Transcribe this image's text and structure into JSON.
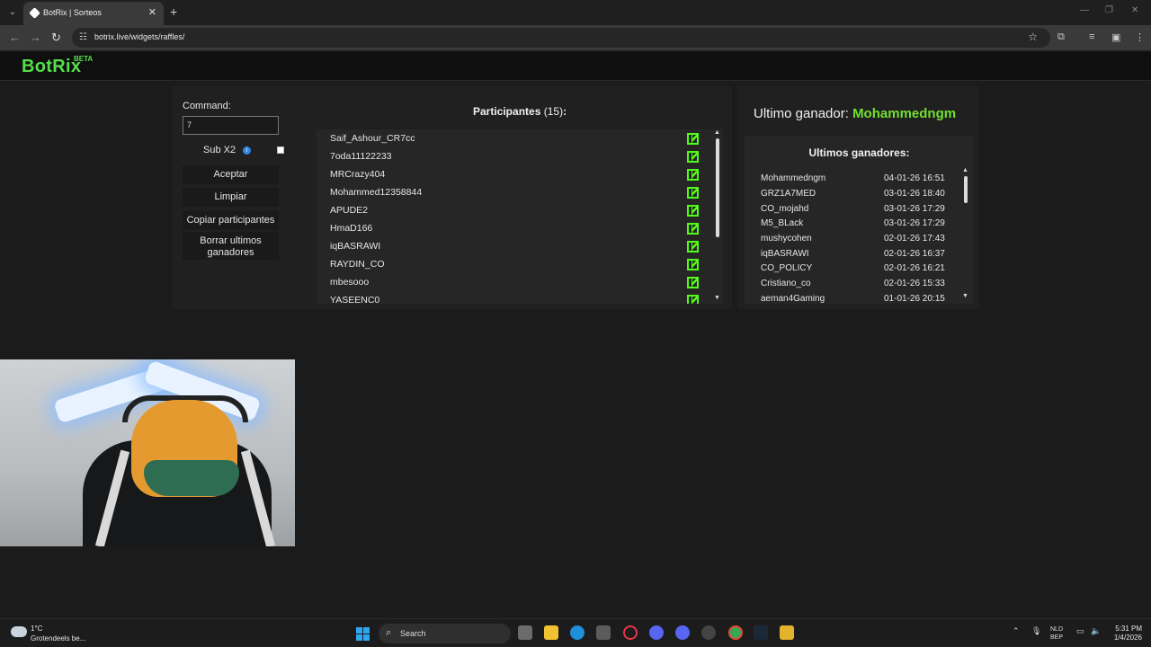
{
  "browser": {
    "tab_title": "BotRix | Sorteos",
    "url": "botrix.live/widgets/raffles/"
  },
  "site": {
    "logo": "BotRix",
    "beta": "BETA"
  },
  "raffle": {
    "command_label": "Command:",
    "command_value": "7",
    "sub_label": "Sub X2",
    "sub_checked": false,
    "buttons": [
      "Aceptar",
      "Limpiar",
      "Copiar participantes",
      "Borrar ultimos ganadores"
    ],
    "participants_title": "Participantes",
    "participants_count": "(15)",
    "participants_suffix": ":",
    "participants": [
      "Saif_Ashour_CR7cc",
      "7oda11122233",
      "MRCrazy404",
      "Mohammed12358844",
      "APUDE2",
      "HmaD166",
      "iqBASRAWI",
      "RAYDIN_CO",
      "mbesooo",
      "YASEENC0"
    ],
    "platform_icon": "kick-icon"
  },
  "winners": {
    "last_winner_label": "Ultimo ganador:",
    "last_winner_name": "Mohammedngm",
    "list_title": "Ultimos ganadores:",
    "list": [
      {
        "name": "Mohammedngm",
        "date": "04-01-26 16:51"
      },
      {
        "name": "GRZ1A7MED",
        "date": "03-01-26 18:40"
      },
      {
        "name": "CO_mojahd",
        "date": "03-01-26 17:29"
      },
      {
        "name": "M5_BLack",
        "date": "03-01-26 17:29"
      },
      {
        "name": "mushycohen",
        "date": "02-01-26 17:43"
      },
      {
        "name": "iqBASRAWI",
        "date": "02-01-26 16:37"
      },
      {
        "name": "CO_POLICY",
        "date": "02-01-26 16:21"
      },
      {
        "name": "Cristiano_co",
        "date": "02-01-26 15:33"
      },
      {
        "name": "aeman4Gaming",
        "date": "01-01-26 20:15"
      }
    ]
  },
  "taskbar": {
    "temperature": "1°C",
    "weather": "Grotendeels be...",
    "search": "Search",
    "lang_top": "NLD",
    "lang_bottom": "BEP",
    "time": "5:31 PM",
    "date": "1/4/2026"
  },
  "colors": {
    "brand_green": "#55e04a",
    "kick_green": "#53fc18",
    "winner_green": "#72e02f"
  }
}
